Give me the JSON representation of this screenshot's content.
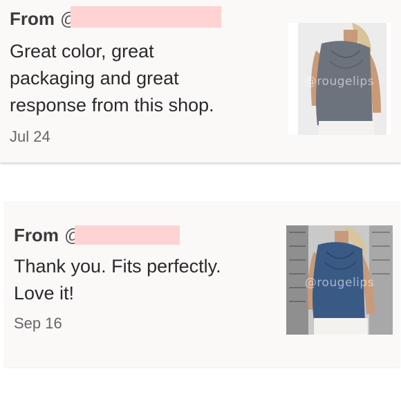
{
  "reviews": [
    {
      "from_label": "From",
      "handle_visible": "@",
      "text": "Great color, great\npackaging and great\nresponse from this shop.",
      "date": "Jul 24",
      "photo": {
        "watermark": "@rougelips",
        "top_color": "#6d737d",
        "background": "#eeeeee"
      }
    },
    {
      "from_label": "From",
      "handle_visible": "@",
      "text": "Thank you. Fits perfectly.\nLove it!",
      "date": "Sep 16",
      "photo": {
        "watermark": "@rougelips",
        "top_color": "#3a5a86",
        "background": "#c9c9c9"
      }
    }
  ],
  "colors": {
    "card_background": "#fbf8f8",
    "redaction": "#ffd3d3"
  }
}
